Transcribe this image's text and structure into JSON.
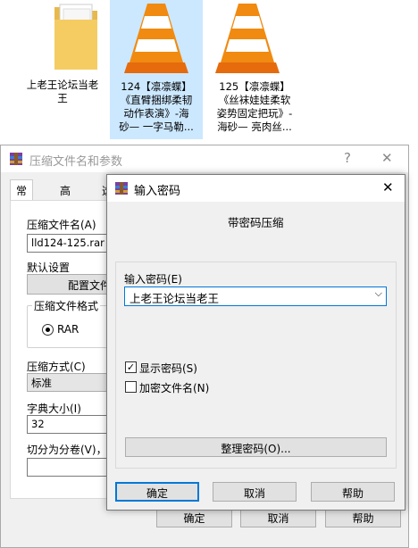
{
  "files": [
    {
      "name": "上老王论坛当老王",
      "line1": "上老王论坛当老",
      "line2": "王",
      "icon": "folder-icon"
    },
    {
      "line1": "124【凛凛蝶】",
      "line2": "《直臂捆绑柔韧",
      "line3": "动作表演》-海",
      "line4": "砂— 一字马勒...",
      "icon": "vlc-cone-icon"
    },
    {
      "line1": "125【凛凛蝶】",
      "line2": "《丝袜娃娃柔软",
      "line3": "姿势固定把玩》-",
      "line4": "海砂— 亮肉丝...",
      "icon": "vlc-cone-icon"
    }
  ],
  "main_dialog": {
    "title": "压缩文件名和参数",
    "help_glyph": "?",
    "close_glyph": "✕",
    "tabs": [
      "常规",
      "高级",
      "选"
    ],
    "archive_name_label": "压缩文件名(A)",
    "archive_name_value": "lld124-125.rar",
    "default_settings_label": "默认设置",
    "config_button": "配置文件",
    "format_group_label": "压缩文件格式",
    "format_value": "RAR",
    "method_label": "压缩方式(C)",
    "method_value": "标准",
    "dict_label": "字典大小(I)",
    "dict_value": "32",
    "split_label": "切分为分卷(V)，大",
    "ok_button": "确定",
    "cancel_button": "取消",
    "help_button": "帮助"
  },
  "password_dialog": {
    "title": "输入密码",
    "close_glyph": "✕",
    "header": "带密码压缩",
    "password_label": "输入密码(E)",
    "password_value": "上老王论坛当老王",
    "show_password_label": "显示密码(S)",
    "show_password_checked": true,
    "encrypt_filenames_label": "加密文件名(N)",
    "encrypt_filenames_checked": false,
    "organize_button": "整理密码(O)...",
    "ok_button": "确定",
    "cancel_button": "取消",
    "help_button": "帮助"
  }
}
